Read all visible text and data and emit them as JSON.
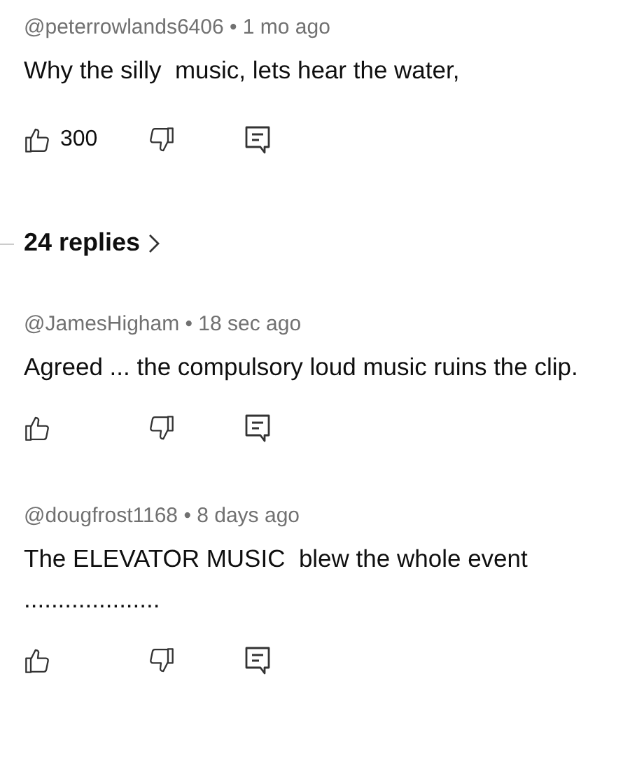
{
  "comments": [
    {
      "meta": "@peterrowlands6406 • 1 mo ago",
      "text": "Why the silly  music, lets hear the water,",
      "likes": "300",
      "replies": "24 replies"
    },
    {
      "meta": "@JamesHigham • 18 sec ago",
      "text": "Agreed ... the compulsory loud music ruins the clip."
    },
    {
      "meta": "@dougfrost1168 • 8 days ago",
      "text": "The ELEVATOR MUSIC  blew the whole event\n...................."
    }
  ]
}
